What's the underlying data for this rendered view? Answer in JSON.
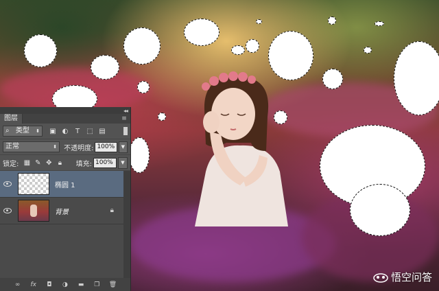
{
  "panel": {
    "tab_title": "图层",
    "collapse_glyph": "◂◂",
    "menu_icon": "menu-lines-icon",
    "filter": {
      "kind_label": "类型",
      "search_icon": "search-icon"
    },
    "filter_icons": [
      "image-filter-icon",
      "adjustment-filter-icon",
      "text-filter-icon",
      "shape-filter-icon",
      "smart-object-filter-icon"
    ],
    "blend_mode": "正常",
    "opacity_label": "不透明度:",
    "opacity_value": "100%",
    "lock_label": "锁定:",
    "lock_icons": [
      "lock-transparency-icon",
      "lock-brush-icon",
      "lock-move-icon",
      "lock-all-icon"
    ],
    "fill_label": "填充:",
    "fill_value": "100%",
    "layers": [
      {
        "name": "椭圆 1",
        "selected": true,
        "visible": true
      },
      {
        "name": "背景",
        "selected": false,
        "visible": true,
        "locked": true
      }
    ],
    "bottom_icons": [
      "link-icon",
      "fx-icon",
      "mask-icon",
      "adjustment-icon",
      "folder-icon",
      "new-layer-icon",
      "trash-icon"
    ]
  },
  "watermark": {
    "text": "悟空问答"
  },
  "colors": {
    "panel_bg": "#535353",
    "selected_layer": "#5a6b80",
    "selection_fill": "#ffffff"
  }
}
